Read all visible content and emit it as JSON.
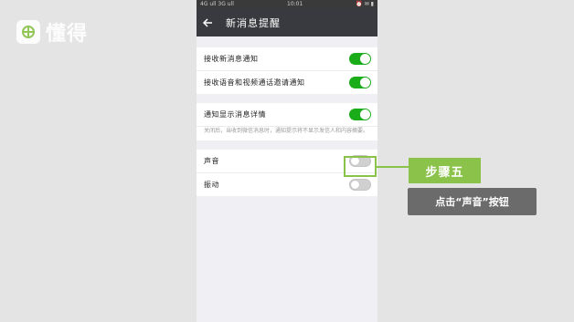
{
  "watermark": {
    "brand": "懂得",
    "icon": "dongde-logo-icon"
  },
  "statusbar": {
    "left": "4G ull 3G ull",
    "center": "10:01",
    "right": "⏰ ✉ ▮"
  },
  "header": {
    "back_icon": "arrow-left-icon",
    "title": "新消息提醒"
  },
  "groups": [
    {
      "rows": [
        {
          "label": "接收新消息通知",
          "toggle": "on"
        },
        {
          "label": "接收语音和视频通话邀请通知",
          "toggle": "on"
        }
      ]
    },
    {
      "rows": [
        {
          "label": "通知显示消息详情",
          "toggle": "on"
        }
      ],
      "hint": "关闭后，当收到微信消息时，通知提示将不显示发信人和内容摘要。"
    },
    {
      "rows": [
        {
          "label": "声音",
          "toggle": "off"
        },
        {
          "label": "振动",
          "toggle": "off"
        }
      ]
    }
  ],
  "annotation": {
    "step": "步骤五",
    "instruction": "点击“声音”按钮"
  },
  "colors": {
    "accent_green": "#8bc34a",
    "toggle_on": "#1aad19",
    "header_bg": "#393a3f"
  }
}
